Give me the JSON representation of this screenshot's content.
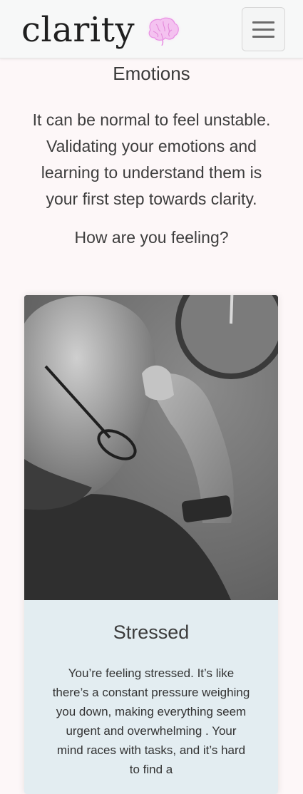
{
  "nav": {
    "brand": "clarity",
    "brand_icon": "brain-icon",
    "menu_icon": "hamburger-menu-icon"
  },
  "page": {
    "heading": "Emotions",
    "intro": "It can be normal to feel unstable. Validating your emotions and learning to understand them is your first step towards clarity.",
    "question": "How are you feeling?"
  },
  "card": {
    "image_icon": "stressed-man-photo",
    "title": "Stressed",
    "text": "You’re feeling stressed. It’s like there’s a constant pressure weighing you down, making everything seem urgent and overwhelming . Your mind races with tasks, and it’s hard to find a"
  },
  "colors": {
    "background": "#fdf7f8",
    "navbar": "#f7f8f8",
    "card_body": "#e3edf1",
    "brain_accent": "#f2b6ee"
  }
}
